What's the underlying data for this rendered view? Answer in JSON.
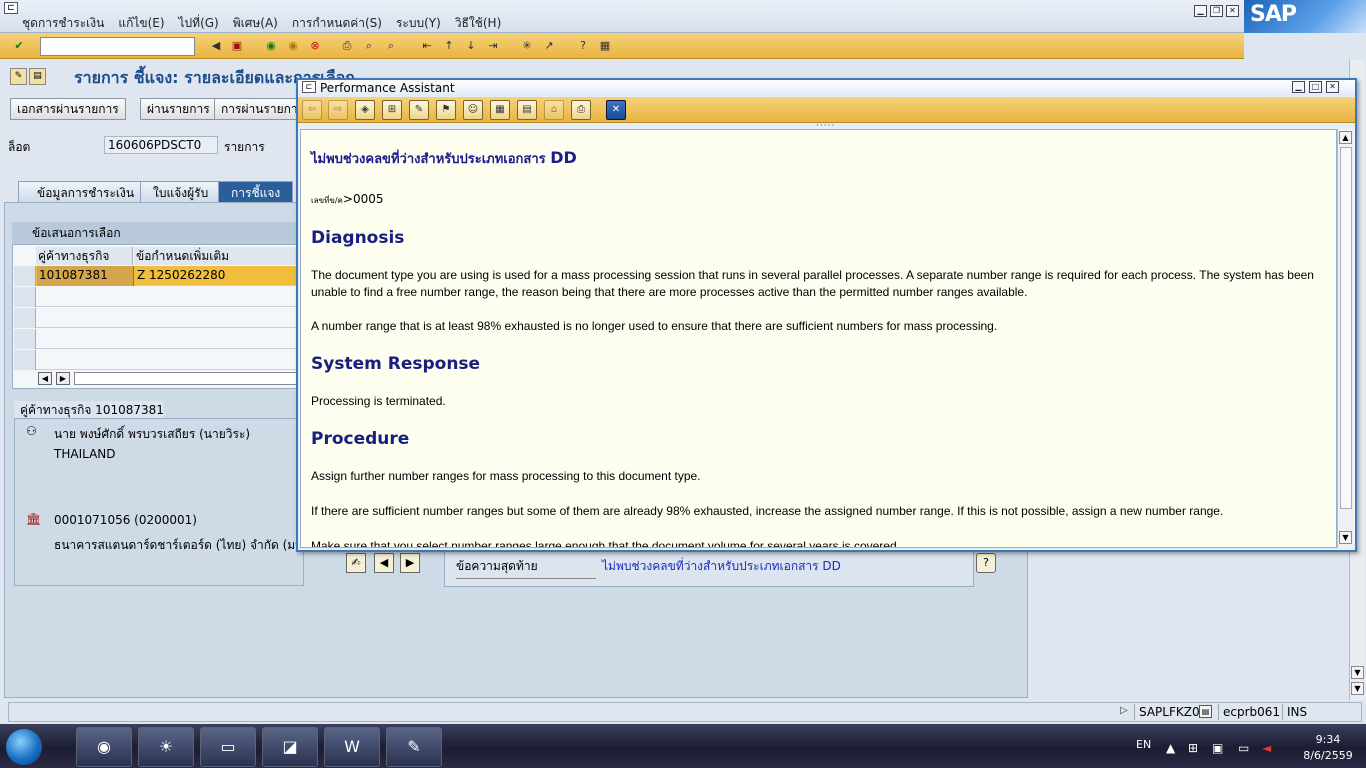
{
  "menu": {
    "items": [
      "ชุดการชำระเงิน",
      "แก้ไข(E)",
      "ไปที่(G)",
      "พิเศษ(A)",
      "การกำหนดค่า(S)",
      "ระบบ(Y)",
      "วิธีใช้(H)"
    ]
  },
  "sap_logo": "SAP",
  "toolbar": {
    "command_value": ""
  },
  "screen": {
    "title": "รายการ ชี้แจง: รายละเอียดและการเลือก",
    "buttons": [
      "เอกสารผ่านรายการ",
      "ผ่านรายการ",
      "การผ่านรายการ"
    ],
    "lot_label": "ล็อต",
    "lot_value": "160606PDSCT0",
    "item_label": "รายการ",
    "tabs": [
      "ข้อมูลการชำระเงิน",
      "ใบแจ้งผู้รับ",
      "การชี้แจง"
    ],
    "active_tab": "การชี้แจง"
  },
  "proposal": {
    "header": "ข้อเสนอการเลือก",
    "columns": [
      "คู่ค้าทางธุรกิจ",
      "ข้อกำหนดเพิ่มเติม"
    ],
    "rows": [
      {
        "partner": "101087381",
        "spec": "Z 1250262280"
      }
    ]
  },
  "partner": {
    "header": "คู่ค้าทางธุรกิจ 101087381",
    "name": "นาย พงษ์ศักดิ์ พรบวรเสถียร (นายวิระ)",
    "country": "THAILAND",
    "bank_account": "0001071056 (0200001)",
    "bank_name": "ธนาคารสแตนดาร์ดชาร์เตอร์ด (ไทย) จำกัด (มหาช"
  },
  "message": {
    "label": "ข้อความสุดท้าย",
    "text": "ไม่พบช่วงคลขที่ว่างสำหรับประเภทเอกสาร DD"
  },
  "status_bar": {
    "program": "SAPLFKZ0",
    "server": "ecprb061",
    "mode": "INS"
  },
  "taskbar": {
    "language": "EN",
    "time": "9:34",
    "date": "8/6/2559"
  },
  "performance_assistant": {
    "window_title": "Performance Assistant",
    "heading_prefix": "ไม่พบช่วงคลขที่ว่างสำหรับประเภทเอกสาร",
    "heading_doc": "DD",
    "message_no_label": "เลขที่ข/ค",
    "message_no": ">0005",
    "diagnosis_title": "Diagnosis",
    "diagnosis_p1": "The document type you are using is used for a mass processing session that runs in several parallel processes. A separate number range is required for each process. The system has been unable to find a free number range, the reason being that there are more processes active than the permitted number ranges available.",
    "diagnosis_p2": "A number range that is at least 98% exhausted is no longer used to ensure that there are sufficient numbers for mass processing.",
    "response_title": "System Response",
    "response_p1": "Processing is terminated.",
    "procedure_title": "Procedure",
    "procedure_p1": "Assign further number ranges for mass processing to this document type.",
    "procedure_p2": "If there are sufficient number ranges but some of them are already 98% exhausted, increase the assigned number range. If this is not possible, assign a new number range.",
    "procedure_p3": "Make sure that you select number ranges large enough that the document volume for several years is covered."
  },
  "colors": {
    "toolbar_gold": "#e9b441",
    "title_blue": "#1c4c8c",
    "heading_navy": "#17207e",
    "selected_row": "#f0be3c"
  }
}
